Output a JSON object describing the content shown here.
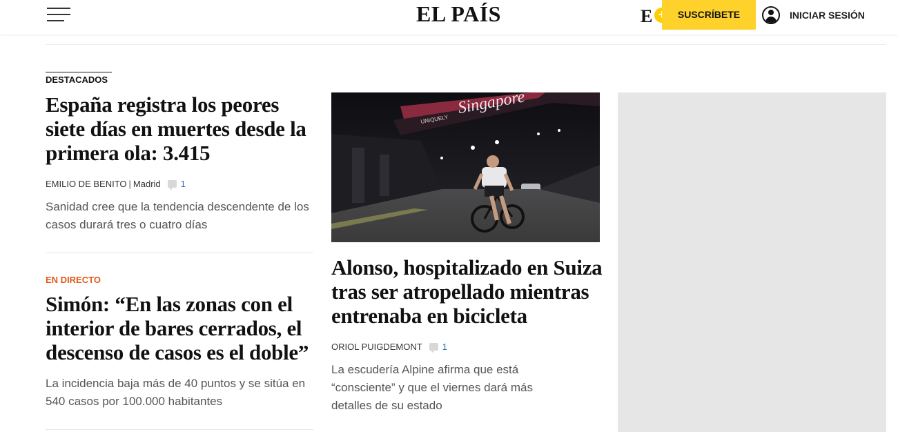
{
  "header": {
    "logo": "EL PAÍS",
    "eplus_letter": "E",
    "eplus_plus": "+",
    "subscribe_label": "SUSCRÍBETE",
    "login_label": "INICIAR SESIÓN"
  },
  "section": {
    "label": "DESTACADOS"
  },
  "articles": [
    {
      "headline": "España registra los peores siete días en muertes desde la primera ola: 3.415",
      "author": "EMILIO DE BENITO",
      "location": "Madrid",
      "comments": "1",
      "summary": "Sanidad cree que la tendencia descendente de los casos durará tres o cuatro días"
    },
    {
      "kicker": "EN DIRECTO",
      "headline": "Simón: “En las zonas con el interior de bares cerrados, el descenso de casos es el doble”",
      "summary": "La incidencia baja más de 40 puntos y se sitúa en 540 casos por 100.000 habitantes"
    },
    {
      "headline": "Alonso, hospitalizado en Suiza tras ser atropellado mientras entrenaba en bicicleta",
      "author": "ORIOL PUIGDEMONT",
      "comments": "1",
      "summary": "La escudería Alpine afirma que está “consciente” y que el viernes dará más detalles de su estado",
      "photo_sign_text": "Singapore",
      "photo_sign_small": "UNIQUELY"
    }
  ],
  "colors": {
    "accent": "#ffd22b",
    "live": "#e0581a",
    "link": "#2a6ebb"
  }
}
